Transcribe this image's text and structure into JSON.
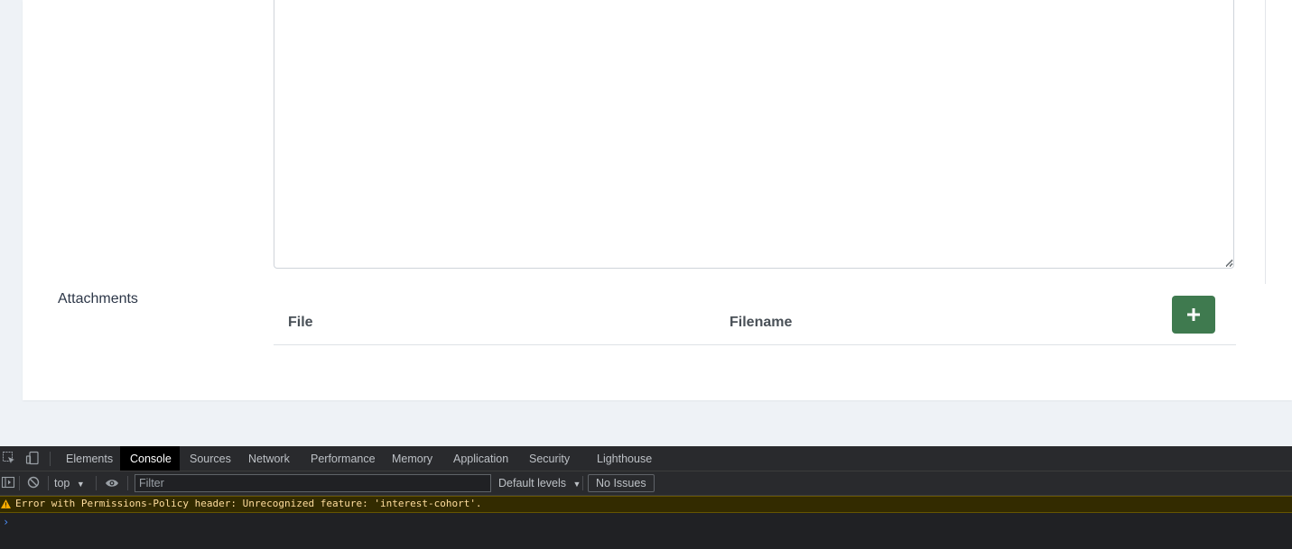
{
  "form": {
    "attachments_label": "Attachments",
    "table": {
      "columns": [
        "File",
        "Filename"
      ],
      "add_button_icon": "plus-icon"
    },
    "accent_color": "#3f7a4f"
  },
  "devtools": {
    "tabs": [
      {
        "label": "Elements",
        "active": false
      },
      {
        "label": "Console",
        "active": true
      },
      {
        "label": "Sources",
        "active": false
      },
      {
        "label": "Network",
        "active": false
      },
      {
        "label": "Performance",
        "active": false
      },
      {
        "label": "Memory",
        "active": false
      },
      {
        "label": "Application",
        "active": false
      },
      {
        "label": "Security",
        "active": false
      },
      {
        "label": "Lighthouse",
        "active": false
      }
    ],
    "toolbar": {
      "context": "top",
      "filter_placeholder": "Filter",
      "levels": "Default levels",
      "issues": "No Issues"
    },
    "messages": [
      {
        "level": "warning",
        "text": "Error with Permissions-Policy header: Unrecognized feature: 'interest-cohort'."
      }
    ],
    "prompt": "›"
  }
}
